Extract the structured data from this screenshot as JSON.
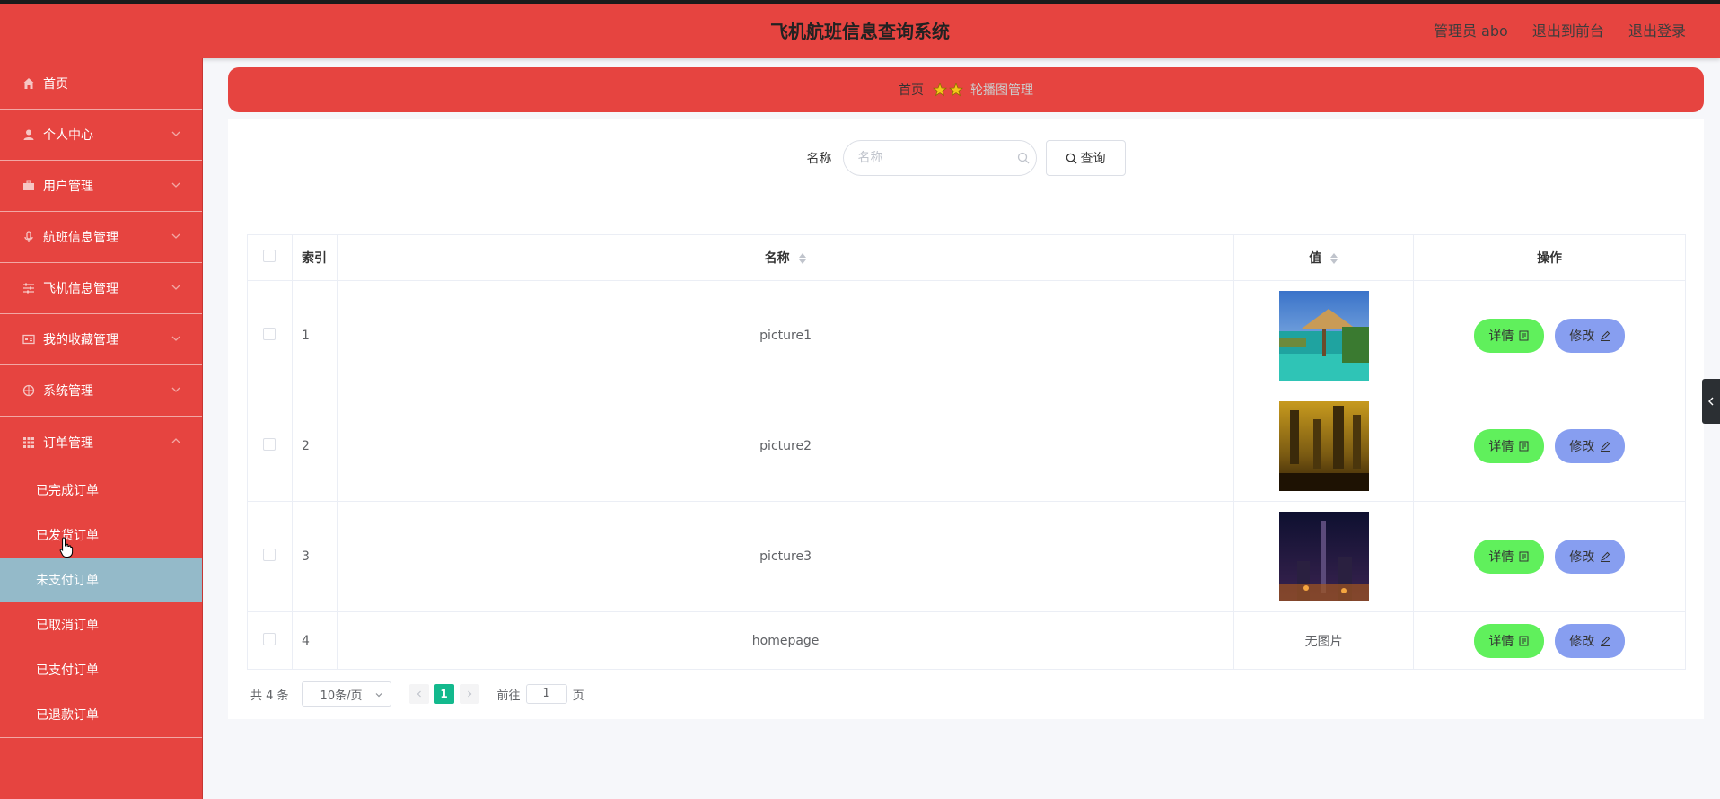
{
  "header": {
    "title": "飞机航班信息查询系统",
    "admin": "管理员 abo",
    "to_front": "退出到前台",
    "logout": "退出登录"
  },
  "sidebar": {
    "items": [
      {
        "label": "首页",
        "icon": "home-icon"
      },
      {
        "label": "个人中心",
        "icon": "user-icon"
      },
      {
        "label": "用户管理",
        "icon": "briefcase-icon"
      },
      {
        "label": "航班信息管理",
        "icon": "microphone-icon"
      },
      {
        "label": "飞机信息管理",
        "icon": "sliders-icon"
      },
      {
        "label": "我的收藏管理",
        "icon": "id-card-icon"
      },
      {
        "label": "系统管理",
        "icon": "globe-icon"
      },
      {
        "label": "订单管理",
        "icon": "grid-icon"
      }
    ],
    "sub_items": [
      "已完成订单",
      "已发货订单",
      "未支付订单",
      "已取消订单",
      "已支付订单",
      "已退款订单"
    ],
    "active_sub": "未支付订单"
  },
  "breadcrumb": {
    "home": "首页",
    "current": "轮播图管理"
  },
  "search": {
    "label": "名称",
    "placeholder": "名称",
    "button": "查询"
  },
  "table": {
    "headers": {
      "index": "索引",
      "name": "名称",
      "value": "值",
      "actions": "操作"
    },
    "rows": [
      {
        "index": "1",
        "name": "picture1",
        "value": "image",
        "image_kind": "beach"
      },
      {
        "index": "2",
        "name": "picture2",
        "value": "image",
        "image_kind": "golden"
      },
      {
        "index": "3",
        "name": "picture3",
        "value": "image",
        "image_kind": "night-city"
      },
      {
        "index": "4",
        "name": "homepage",
        "value": "无图片",
        "image_kind": ""
      }
    ],
    "detail_label": "详情",
    "edit_label": "修改"
  },
  "pagination": {
    "total": "共 4 条",
    "page_size": "10条/页",
    "current_page": "1",
    "goto_prefix": "前往",
    "goto_value": "1",
    "goto_suffix": "页"
  },
  "colors": {
    "primary": "#e64440",
    "active_sub_bg": "#94bac9",
    "detail_btn": "#60f05c",
    "edit_btn": "#879ef0",
    "page_active": "#13b98d"
  }
}
